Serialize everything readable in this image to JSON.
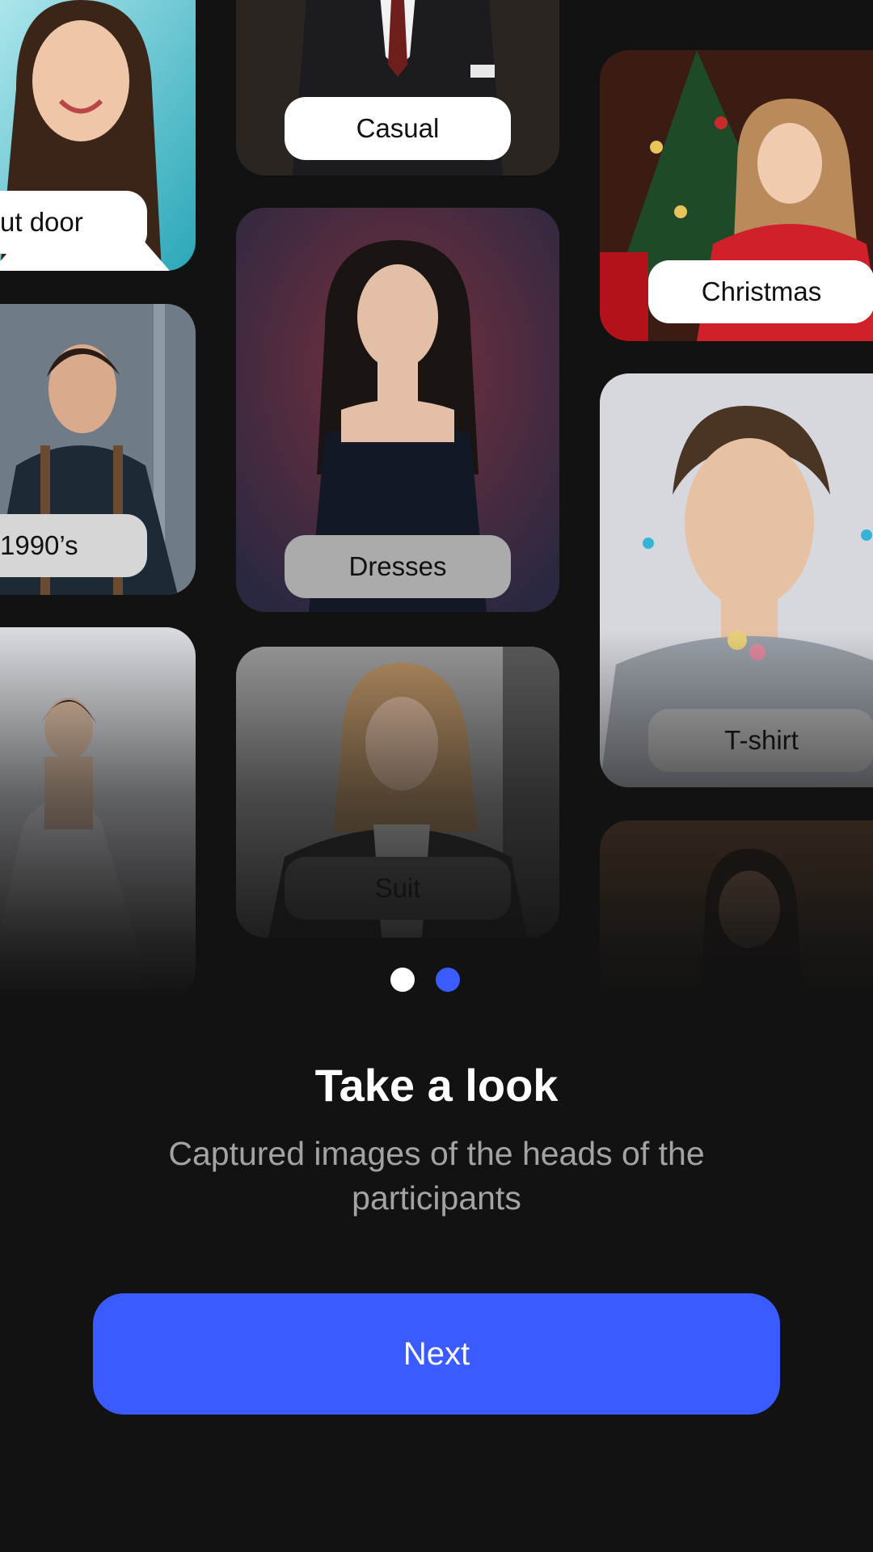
{
  "cards": [
    {
      "label": "ut door",
      "subject": "smiling woman on teal background"
    },
    {
      "label": "1990’s",
      "subject": "man with suspenders"
    },
    {
      "label": "",
      "subject": "woman in white gown"
    },
    {
      "label": "Casual",
      "subject": "man in suit and tie"
    },
    {
      "label": "Dresses",
      "subject": "woman in dark dress"
    },
    {
      "label": "Suit",
      "subject": "woman in blazer"
    },
    {
      "label": "Christmas",
      "subject": "girl in christmas sweater"
    },
    {
      "label": "T-shirt",
      "subject": "young man in t-shirt"
    },
    {
      "label": "",
      "subject": "woman in dim room"
    }
  ],
  "pagination": {
    "count": 2,
    "active": 2
  },
  "title": "Take a look",
  "subtitle": "Captured images of the heads of the participants",
  "next_label": "Next",
  "colors": {
    "background": "#121212",
    "accent": "#3a5bff",
    "pill": "#ffffff",
    "subtitle": "#a3a3a3"
  }
}
